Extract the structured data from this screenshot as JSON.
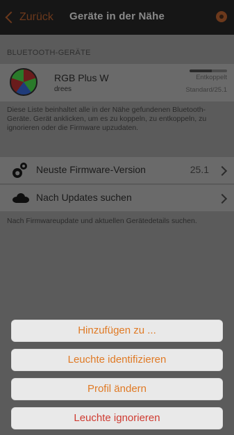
{
  "topbar": {
    "back_label": "Zurück",
    "title": "Geräte in der Nähe",
    "icons": {
      "back": "chevron-left-icon",
      "alert": "alert-icon"
    }
  },
  "bluetooth": {
    "section_title": "BLUETOOTH-GERÄTE",
    "device": {
      "name": "RGB Plus W",
      "subtitle": "drees",
      "status": "Entkoppelt",
      "version": "Standard/25.1",
      "signal_level": 0.6,
      "icon": "rgb-device-icon"
    },
    "description": "Diese Liste beinhaltet alle in der Nähe gefundenen Bluetooth-Geräte. Gerät anklicken, um es zu koppeln, zu entkoppeln, zu ignorieren oder die Firmware upzudaten."
  },
  "firmware": {
    "latest_label": "Neuste Firmware-Version",
    "latest_value": "25.1",
    "check_label": "Nach Updates suchen",
    "note": "Nach Firmwareupdate und aktuellen Gerätedetails suchen.",
    "icons": {
      "latest": "gears-icon",
      "check": "cloud-icon"
    }
  },
  "action_sheet": {
    "items": [
      {
        "label": "Hinzufügen zu ..."
      },
      {
        "label": "Leuchte identifizieren"
      },
      {
        "label": "Profil ändern"
      },
      {
        "label": "Leuchte ignorieren"
      }
    ],
    "colors": {
      "primary": "#e07a25",
      "destructive": "#cf3b31"
    }
  }
}
